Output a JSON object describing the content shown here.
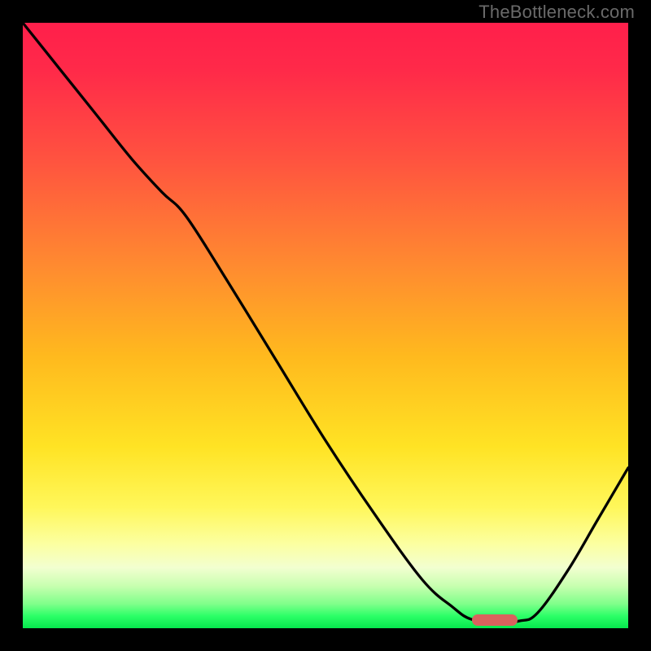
{
  "watermark": "TheBottleneck.com",
  "marker": {
    "color": "#d9625e",
    "cx_frac": 0.78,
    "cy_frac": 0.987
  },
  "curve": {
    "stroke": "#000000",
    "stroke_width": 3.3
  },
  "chart_data": {
    "type": "line",
    "title": "",
    "xlabel": "",
    "ylabel": "",
    "xlim": [
      0,
      1
    ],
    "ylim": [
      0,
      1
    ],
    "note": "Axes are unlabeled in the source; x and y are normalized 0–1 within the plot frame. y increases downward (top=0, bottom=1).",
    "series": [
      {
        "name": "bottleneck-curve",
        "x": [
          0.0,
          0.06,
          0.12,
          0.18,
          0.23,
          0.27,
          0.34,
          0.42,
          0.5,
          0.58,
          0.66,
          0.71,
          0.74,
          0.78,
          0.82,
          0.85,
          0.9,
          0.95,
          1.0
        ],
        "y": [
          0.0,
          0.075,
          0.15,
          0.225,
          0.28,
          0.32,
          0.43,
          0.56,
          0.69,
          0.81,
          0.92,
          0.965,
          0.985,
          0.99,
          0.988,
          0.975,
          0.905,
          0.82,
          0.735
        ]
      }
    ],
    "marker_point": {
      "x": 0.78,
      "y": 0.987
    },
    "gradient_stops": [
      {
        "pos": 0.0,
        "color": "#ff1f4b"
      },
      {
        "pos": 0.4,
        "color": "#ff8a30"
      },
      {
        "pos": 0.7,
        "color": "#ffe324"
      },
      {
        "pos": 0.9,
        "color": "#f2ffd0"
      },
      {
        "pos": 1.0,
        "color": "#06e84d"
      }
    ]
  }
}
